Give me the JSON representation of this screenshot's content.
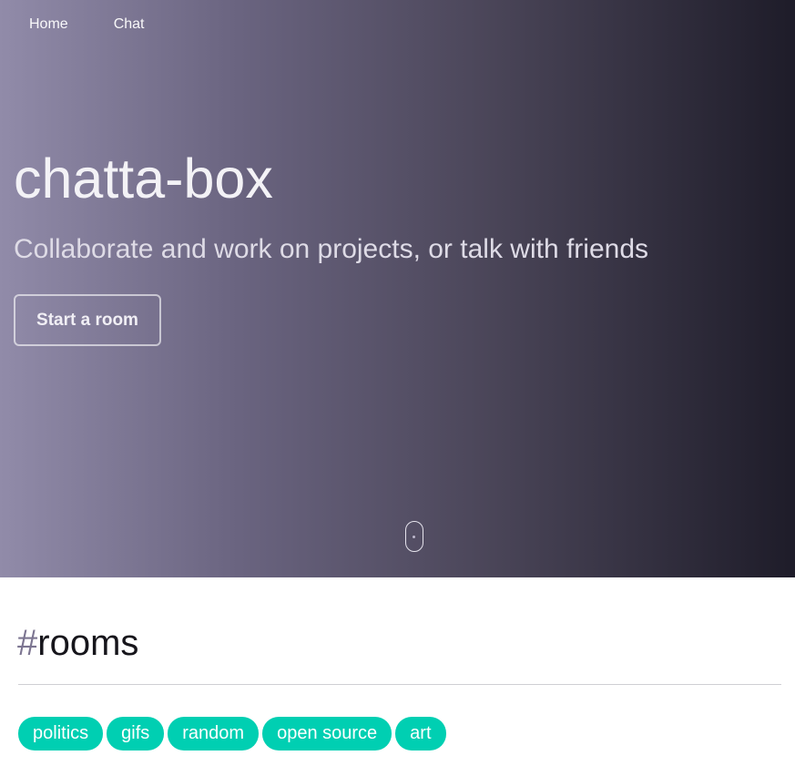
{
  "nav": {
    "items": [
      {
        "label": "Home"
      },
      {
        "label": "Chat"
      }
    ]
  },
  "hero": {
    "title": "chatta-box",
    "subtitle": "Collaborate and work on projects, or talk with friends",
    "cta_label": "Start a room"
  },
  "rooms": {
    "hash": "#",
    "heading": "rooms",
    "tags": [
      {
        "label": "politics"
      },
      {
        "label": "gifs"
      },
      {
        "label": "random"
      },
      {
        "label": "open source"
      },
      {
        "label": "art"
      }
    ]
  },
  "colors": {
    "hero_gradient_start": "#918ba9",
    "hero_gradient_end": "#1e1c29",
    "tag_background": "#00cfb2",
    "hash_color": "#7c7591"
  },
  "icons": {
    "scroll_indicator": "mouse-scroll-icon"
  }
}
